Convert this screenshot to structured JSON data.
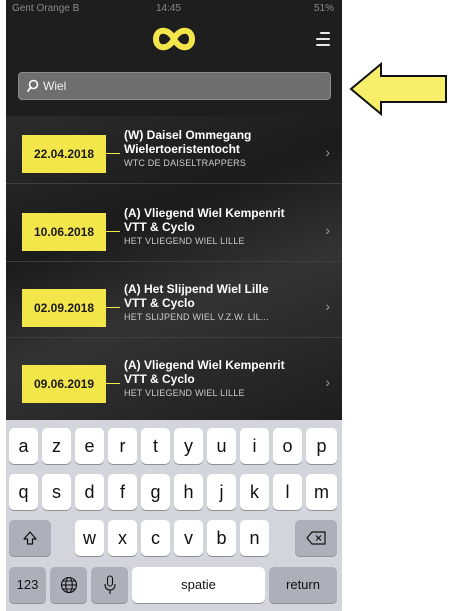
{
  "statusbar": {
    "carrier": "Gent Orange B",
    "time": "14:45",
    "battery": "51%"
  },
  "search": {
    "value": "Wiel"
  },
  "events": [
    {
      "date": "22.04.2018",
      "title_line1": "(W) Daisel Ommegang",
      "title_line2": "Wielertoeristentocht",
      "club": "WTC DE DAISELTRAPPERS"
    },
    {
      "date": "10.06.2018",
      "title_line1": "(A) Vliegend Wiel Kempenrit",
      "title_line2": "VTT & Cyclo",
      "club": "HET VLIEGEND WIEL LILLE"
    },
    {
      "date": "02.09.2018",
      "title_line1": "(A) Het Slijpend Wiel Lille",
      "title_line2": "VTT & Cyclo",
      "club": "HET SLIJPEND WIEL V.Z.W. LIL..."
    },
    {
      "date": "09.06.2019",
      "title_line1": "(A) Vliegend Wiel Kempenrit",
      "title_line2": "VTT & Cyclo",
      "club": "HET VLIEGEND WIEL LILLE"
    }
  ],
  "keyboard": {
    "row1": [
      "a",
      "z",
      "e",
      "r",
      "t",
      "y",
      "u",
      "i",
      "o",
      "p"
    ],
    "row2": [
      "q",
      "s",
      "d",
      "f",
      "g",
      "h",
      "j",
      "k",
      "l",
      "m"
    ],
    "row3": [
      "w",
      "x",
      "c",
      "v",
      "b",
      "n"
    ],
    "numbers": "123",
    "space": "spatie",
    "return": "return"
  },
  "colors": {
    "accent": "#f3e64a",
    "background": "#1e1e1e",
    "arrow": "#f7ef6a"
  },
  "icons": [
    "logo-icon",
    "menu-icon",
    "search-icon",
    "chevron-right-icon",
    "shift-icon",
    "backspace-icon",
    "globe-icon",
    "microphone-icon",
    "arrow-icon"
  ]
}
